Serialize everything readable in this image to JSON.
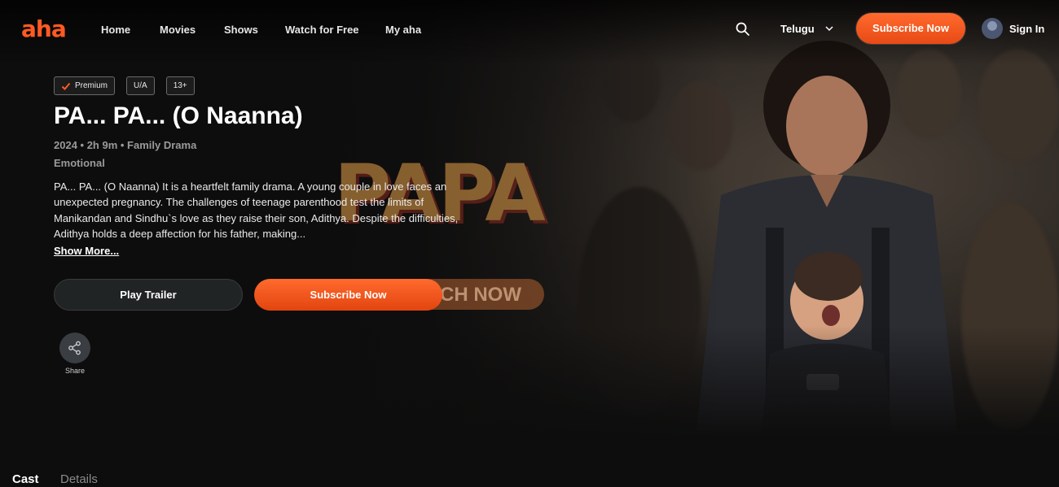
{
  "nav": {
    "logo": "aha",
    "links": [
      "Home",
      "Movies",
      "Shows",
      "Watch for Free",
      "My aha"
    ],
    "language": "Telugu",
    "subscribe": "Subscribe Now",
    "signin": "Sign In"
  },
  "hero": {
    "tags": [
      "Premium",
      "U/A",
      "13+"
    ],
    "title": "PA... PA... (O Naanna)",
    "meta": "2024 • 2h 9m • Family Drama",
    "mood": "Emotional",
    "description": "PA... PA... (O Naanna) It is a heartfelt family drama. A young couple in love faces an unexpected pregnancy. The challenges of teenage parenthood test the limits of Manikandan and Sindhu`s love as they raise their son, Adithya. Despite the difficulties, Adithya holds a deep affection for his father, making...",
    "show_more": "Show More...",
    "play_trailer": "Play Trailer",
    "subscribe": "Subscribe Now",
    "share": "Share",
    "poster_logo": "PAPA",
    "poster_watch": "CH NOW"
  },
  "tabs": [
    "Cast",
    "Details"
  ],
  "colors": {
    "accent": "#ff5a22",
    "background": "#0d0d0d"
  }
}
